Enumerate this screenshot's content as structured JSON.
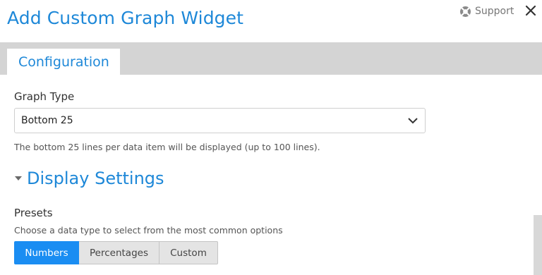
{
  "dialog": {
    "title": "Add Custom Graph Widget"
  },
  "header": {
    "support_label": "Support",
    "support_icon": "lifebuoy-icon",
    "close_icon": "close-icon"
  },
  "tabs": [
    {
      "label": "Configuration",
      "active": true
    }
  ],
  "graph_type": {
    "label": "Graph Type",
    "selected": "Bottom 25",
    "help": "The bottom 25 lines per data item will be displayed (up to 100 lines)."
  },
  "display_settings": {
    "title": "Display Settings",
    "expanded": true
  },
  "presets": {
    "label": "Presets",
    "help": "Choose a data type to select from the most common options",
    "options": [
      {
        "label": "Numbers",
        "active": true
      },
      {
        "label": "Percentages",
        "active": false
      },
      {
        "label": "Custom",
        "active": false
      }
    ]
  },
  "colors": {
    "accent": "#1e88d8",
    "active_button": "#1a8df2",
    "tab_bar": "#d4d4d4"
  }
}
